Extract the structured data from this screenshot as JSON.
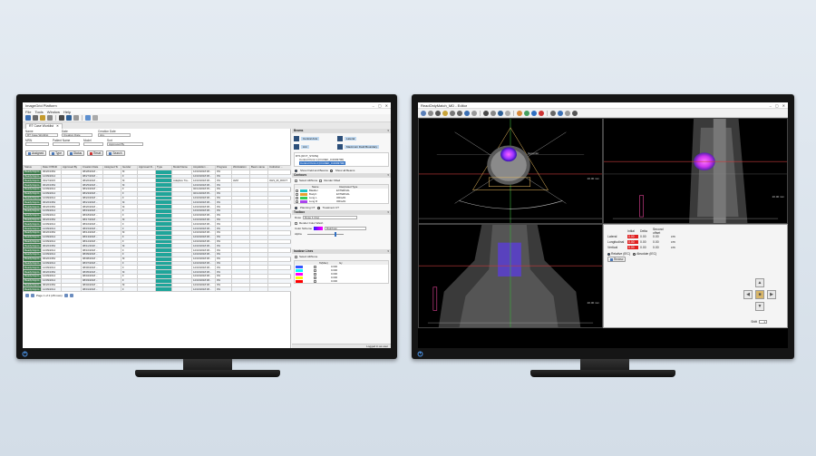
{
  "left_app": {
    "window_title": "ImageGrid Platform",
    "menu": [
      "File",
      "Tools",
      "Window",
      "Help"
    ],
    "tab_label": "RT Case Worklist",
    "filters": {
      "name_label": "Name",
      "name_value": "RT Case Worklist",
      "date_label": "Date",
      "date_value": "Creation Date",
      "creation_date_label": "Creation Date",
      "creation_date_value": "ALL",
      "mrn_label": "MRN",
      "patient_name_label": "Patient Name",
      "model_label": "Model",
      "sort_label": "Sort",
      "sort_value": "Approved By"
    },
    "action_buttons": [
      "Assigned",
      "Type",
      "Status",
      "Reset",
      "Search"
    ],
    "table": {
      "columns": [
        "Status",
        "Date Of Birth",
        "Approved By",
        "Creation Date",
        "Assigned To",
        "Gender",
        "Approved D...",
        "Type",
        "Model Name",
        "Acquisition ...",
        "Progress",
        "Workstation",
        "Beam name",
        "Institution ..."
      ],
      "rows": [
        {
          "status": "Ready/Appro...",
          "dob": "06/26/1954",
          "creation": "08/28/2018 ...",
          "gender": "M",
          "acq": "12/16/2018 08...",
          "progress": "0%"
        },
        {
          "status": "Ready/Appro...",
          "dob": "12/09/2014",
          "creation": "08/27/2018 ...",
          "gender": "F",
          "acq": "12/16/2018 08...",
          "progress": "0%"
        },
        {
          "status": "Ready/Appro...",
          "dob": "03/27/2015",
          "creation": "08/26/2018 ...",
          "gender": "M",
          "model": "Adaptive Tra...",
          "acq": "12/16/2018 08...",
          "progress": "0%",
          "workstation": "AVM",
          "institution": "OHS_RI_ROOT"
        },
        {
          "status": "Ready/Appro...",
          "dob": "06/26/1954",
          "creation": "08/25/2018 ...",
          "gender": "M",
          "acq": "12/16/2018 08...",
          "progress": "0%"
        },
        {
          "status": "Ready/Appro...",
          "dob": "12/09/2014",
          "creation": "08/24/2018 ...",
          "gender": "F",
          "acq": "02/14/2018 05...",
          "progress": "0%"
        },
        {
          "status": "Ready/Appro...",
          "dob": "12/09/2014",
          "creation": "08/23/2018 ...",
          "gender": "F",
          "acq": "02/14/2018 05...",
          "progress": "0%"
        },
        {
          "status": "Ready/Appro...",
          "dob": "12/09/2014",
          "creation": "08/22/2018 ...",
          "gender": "F",
          "acq": "12/16/2018 08...",
          "progress": "0%"
        },
        {
          "status": "Ready/Appro...",
          "dob": "06/26/1954",
          "creation": "08/21/2018 ...",
          "gender": "M",
          "acq": "12/16/2018 08...",
          "progress": "0%"
        },
        {
          "status": "Ready/Appro...",
          "dob": "06/26/1954",
          "creation": "08/20/2018 ...",
          "gender": "M",
          "acq": "12/16/2018 08...",
          "progress": "0%"
        },
        {
          "status": "Ready/Appro...",
          "dob": "12/09/2014",
          "creation": "08/19/2018 ...",
          "gender": "F",
          "acq": "12/16/2018 08...",
          "progress": "0%"
        },
        {
          "status": "Ready/Appro...",
          "dob": "12/09/2014",
          "creation": "08/18/2018 ...",
          "gender": "F",
          "acq": "12/16/2018 08...",
          "progress": "0%"
        },
        {
          "status": "Ready/Appro...",
          "dob": "06/26/1954",
          "creation": "08/17/2018 ...",
          "gender": "M",
          "acq": "12/16/2018 08...",
          "progress": "0%"
        },
        {
          "status": "Ready/Appro...",
          "dob": "12/09/2014",
          "creation": "08/16/2018 ...",
          "gender": "F",
          "acq": "12/16/2018 08...",
          "progress": "0%"
        },
        {
          "status": "Ready/Appro...",
          "dob": "12/09/2014",
          "creation": "08/15/2018 ...",
          "gender": "F",
          "acq": "12/16/2018 08...",
          "progress": "0%"
        },
        {
          "status": "Ready/Appro...",
          "dob": "06/26/1954",
          "creation": "08/14/2018 ...",
          "gender": "M",
          "acq": "12/16/2018 08...",
          "progress": "0%"
        },
        {
          "status": "Ready/Appro...",
          "dob": "12/09/2014",
          "creation": "08/13/2018 ...",
          "gender": "F",
          "acq": "12/16/2018 08...",
          "progress": "0%"
        },
        {
          "status": "Ready/Appro...",
          "dob": "12/09/2014",
          "creation": "08/12/2018 ...",
          "gender": "F",
          "acq": "12/16/2018 08...",
          "progress": "0%"
        },
        {
          "status": "Ready/Appro...",
          "dob": "06/26/1954",
          "creation": "08/11/2018 ...",
          "gender": "M",
          "acq": "12/16/2018 08...",
          "progress": "0%"
        },
        {
          "status": "Ready/Appro...",
          "dob": "12/09/2014",
          "creation": "08/10/2018 ...",
          "gender": "F",
          "acq": "12/16/2018 08...",
          "progress": "0%"
        },
        {
          "status": "Ready/Appro...",
          "dob": "12/09/2014",
          "creation": "08/09/2018 ...",
          "gender": "F",
          "acq": "12/16/2018 08...",
          "progress": "0%"
        },
        {
          "status": "Ready/Appro...",
          "dob": "06/26/1954",
          "creation": "08/08/2018 ...",
          "gender": "M",
          "acq": "12/16/2018 08...",
          "progress": "0%"
        },
        {
          "status": "Ready/Appro...",
          "dob": "12/09/2014",
          "creation": "08/07/2018 ...",
          "gender": "F",
          "acq": "12/16/2018 08...",
          "progress": "0%"
        },
        {
          "status": "Ready/Appro...",
          "dob": "12/09/2014",
          "creation": "08/06/2018 ...",
          "gender": "F",
          "acq": "12/16/2018 08...",
          "progress": "0%"
        },
        {
          "status": "Ready/Appro...",
          "dob": "06/26/1954",
          "creation": "08/05/2018 ...",
          "gender": "M",
          "acq": "12/16/2018 08...",
          "progress": "0%"
        },
        {
          "status": "Ready/Appro...",
          "dob": "12/09/2014",
          "creation": "08/04/2018 ...",
          "gender": "F",
          "acq": "12/16/2018 08...",
          "progress": "0%"
        },
        {
          "status": "Ready/Appro...",
          "dob": "12/09/2014",
          "creation": "08/03/2018 ...",
          "gender": "F",
          "acq": "12/16/2018 08...",
          "progress": "0%"
        },
        {
          "status": "Ready/Appro...",
          "dob": "06/26/1954",
          "creation": "08/02/2018 ...",
          "gender": "M",
          "acq": "12/16/2018 08...",
          "progress": "0%"
        },
        {
          "status": "Ready/Appro...",
          "dob": "12/09/2014",
          "creation": "08/01/2018 ...",
          "gender": "F",
          "acq": "12/16/2018 08...",
          "progress": "0%"
        }
      ]
    },
    "pager_text": "Page 1 of 2 (28 rows)",
    "status_text": "Logged in as user",
    "beams": {
      "header": "Beams",
      "items": [
        "Central Axis",
        "Lateral",
        "Ant",
        "Maximum Field Boundary"
      ],
      "tree_root": "RT1 [RCT_STATE]",
      "tree_child_1": "Control Point 1 [Ori.DEF_0.0003700]",
      "tree_child_2": "Control Point 2 [Ori.DEF_0.0003700]",
      "show_beams": "Show Field and Beams",
      "show_all": "Show all Beams"
    },
    "contours": {
      "header": "Contours",
      "select_all": "Select All/None",
      "render_filled": "Render Filled",
      "columns": [
        "Name",
        "Interpreted Type"
      ],
      "rows": [
        {
          "name": "Bladder",
          "type": "EXTERNAL",
          "color": "#22c4c4"
        },
        {
          "name": "BodyC",
          "type": "EXTERNAL",
          "color": "#e8a030"
        },
        {
          "name": "Lung L",
          "type": "ORGAN",
          "color": "#33cc55"
        },
        {
          "name": "Lung R",
          "type": "ORGAN",
          "color": "#aa44ee"
        }
      ],
      "planning_ct": "Planning CT",
      "treatment_ct": "Treatment CT"
    },
    "toolbox": {
      "header": "Toolbox",
      "dose_label": "Dose",
      "dose_value": "Dose 1 (Gy)",
      "render_color_wash": "Render Color Wash",
      "color_scheme_label": "Color Scheme",
      "color_scheme_value": "Rainbow",
      "alpha_label": "Alpha"
    },
    "isodose": {
      "header": "Isodose Lines",
      "select_all": "Select All/None",
      "columns": [
        "%(Max)",
        "Gy"
      ],
      "rows": [
        {
          "color": "#3355ff",
          "value": "0.000"
        },
        {
          "color": "#00ffff",
          "value": "0.000"
        },
        {
          "color": "#ff00ff",
          "value": "0.000"
        },
        {
          "color": "#ffff00",
          "value": "0.000"
        },
        {
          "color": "#ff0000",
          "value": "0.000"
        }
      ]
    }
  },
  "right_app": {
    "window_title": "ReadOnlyMatch_MD - Editor",
    "view_labels": {
      "axial_scale": "20.00 mm",
      "sagittal_scale": "20.00 mm",
      "coronal_scale": "20.00 mm",
      "isocenter": "Isocenter"
    },
    "shift_panel": {
      "columns": [
        "Initial",
        "Delta",
        "Second offset"
      ],
      "rows": [
        {
          "label": "Lateral",
          "initial": "0.00",
          "delta": "0.00",
          "second": "0.00",
          "unit": "cm"
        },
        {
          "label": "Longitudinal",
          "initial": "0.00",
          "delta": "0.00",
          "second": "0.00",
          "unit": "cm"
        },
        {
          "label": "Vertical",
          "initial": "0.00",
          "delta": "0.00",
          "second": "0.00",
          "unit": "cm"
        }
      ],
      "relative_label": "Relative (IEC)",
      "absolute_label": "Absolute (IEC)",
      "review_button": "Review",
      "shift_label": "Shift",
      "shift_value": "1"
    }
  },
  "colors": {
    "status_green": "#3c7a4a",
    "type_teal": "#1fa59a",
    "selection_blue": "#2f6fc2",
    "shift_red": "#e01f1f"
  }
}
